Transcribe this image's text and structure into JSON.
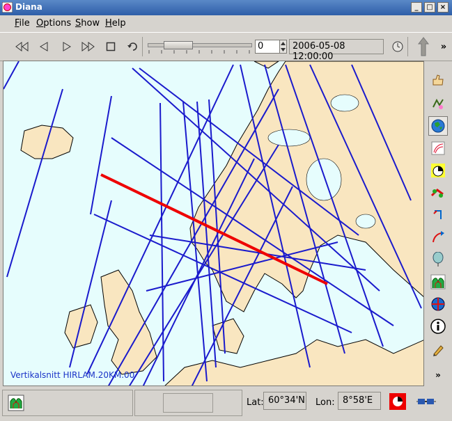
{
  "window": {
    "title": "Diana",
    "controls": [
      "minimize",
      "maximize",
      "close"
    ]
  },
  "menu": [
    {
      "label": "File",
      "mnemonic": "F"
    },
    {
      "label": "Options",
      "mnemonic": "O"
    },
    {
      "label": "Show",
      "mnemonic": "S"
    },
    {
      "label": "Help",
      "mnemonic": "H"
    }
  ],
  "toolbar": {
    "buttons": [
      "rewind-icon",
      "step-back-icon",
      "play-icon",
      "fast-forward-icon",
      "stop-icon",
      "loop-icon"
    ],
    "step_value": "0",
    "datetime": "2006-05-08 12:00:00",
    "more_label": "»"
  },
  "map": {
    "caption": "Vertikalsnitt HIRLAM.20KM.00",
    "colors": {
      "sea": "#e6fdfd",
      "land": "#f9e6c0",
      "coast": "#000000",
      "track": "#1a1acc",
      "selected_track": "#ee0000"
    }
  },
  "sidebar": {
    "tools": [
      "thumbs-up-icon",
      "edit-doodle-icon",
      "globe-icon",
      "satellite-icon",
      "radar-icon",
      "weather-objects-icon",
      "crosshair-icon",
      "trajectory-icon",
      "balloon-icon",
      "vertical-profile-icon",
      "measure-globe-icon",
      "info-icon",
      "pencil-icon",
      "overflow-icon"
    ],
    "overflow_label": "»"
  },
  "status": {
    "lat_label": "Lat:",
    "lat_value": "60°34'N",
    "lon_label": "Lon:",
    "lon_value": "8°58'E"
  }
}
